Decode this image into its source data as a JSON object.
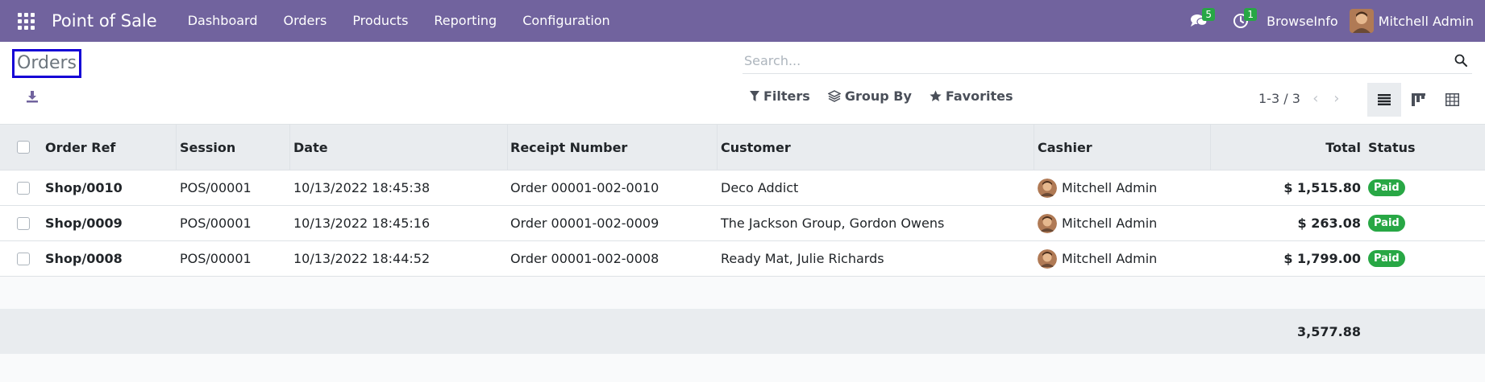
{
  "navbar": {
    "brand": "Point of Sale",
    "menu": [
      "Dashboard",
      "Orders",
      "Products",
      "Reporting",
      "Configuration"
    ],
    "messages_count": "5",
    "activities_count": "1",
    "company": "BrowseInfo",
    "user": "Mitchell Admin",
    "color": "#71639e"
  },
  "page": {
    "title": "Orders",
    "search_placeholder": "Search...",
    "filters_label": "Filters",
    "group_by_label": "Group By",
    "favorites_label": "Favorites",
    "pager": "1-3 / 3"
  },
  "table": {
    "columns": [
      "Order Ref",
      "Session",
      "Date",
      "Receipt Number",
      "Customer",
      "Cashier",
      "Total",
      "Status"
    ],
    "rows": [
      {
        "order_ref": "Shop/0010",
        "session": "POS/00001",
        "date": "10/13/2022 18:45:38",
        "receipt": "Order 00001-002-0010",
        "customer": "Deco Addict",
        "cashier": "Mitchell Admin",
        "total": "$ 1,515.80",
        "status": "Paid"
      },
      {
        "order_ref": "Shop/0009",
        "session": "POS/00001",
        "date": "10/13/2022 18:45:16",
        "receipt": "Order 00001-002-0009",
        "customer": "The Jackson Group, Gordon Owens",
        "cashier": "Mitchell Admin",
        "total": "$ 263.08",
        "status": "Paid"
      },
      {
        "order_ref": "Shop/0008",
        "session": "POS/00001",
        "date": "10/13/2022 18:44:52",
        "receipt": "Order 00001-002-0008",
        "customer": "Ready Mat, Julie Richards",
        "cashier": "Mitchell Admin",
        "total": "$ 1,799.00",
        "status": "Paid"
      }
    ],
    "sum_total": "3,577.88",
    "status_color": "#28a745"
  }
}
